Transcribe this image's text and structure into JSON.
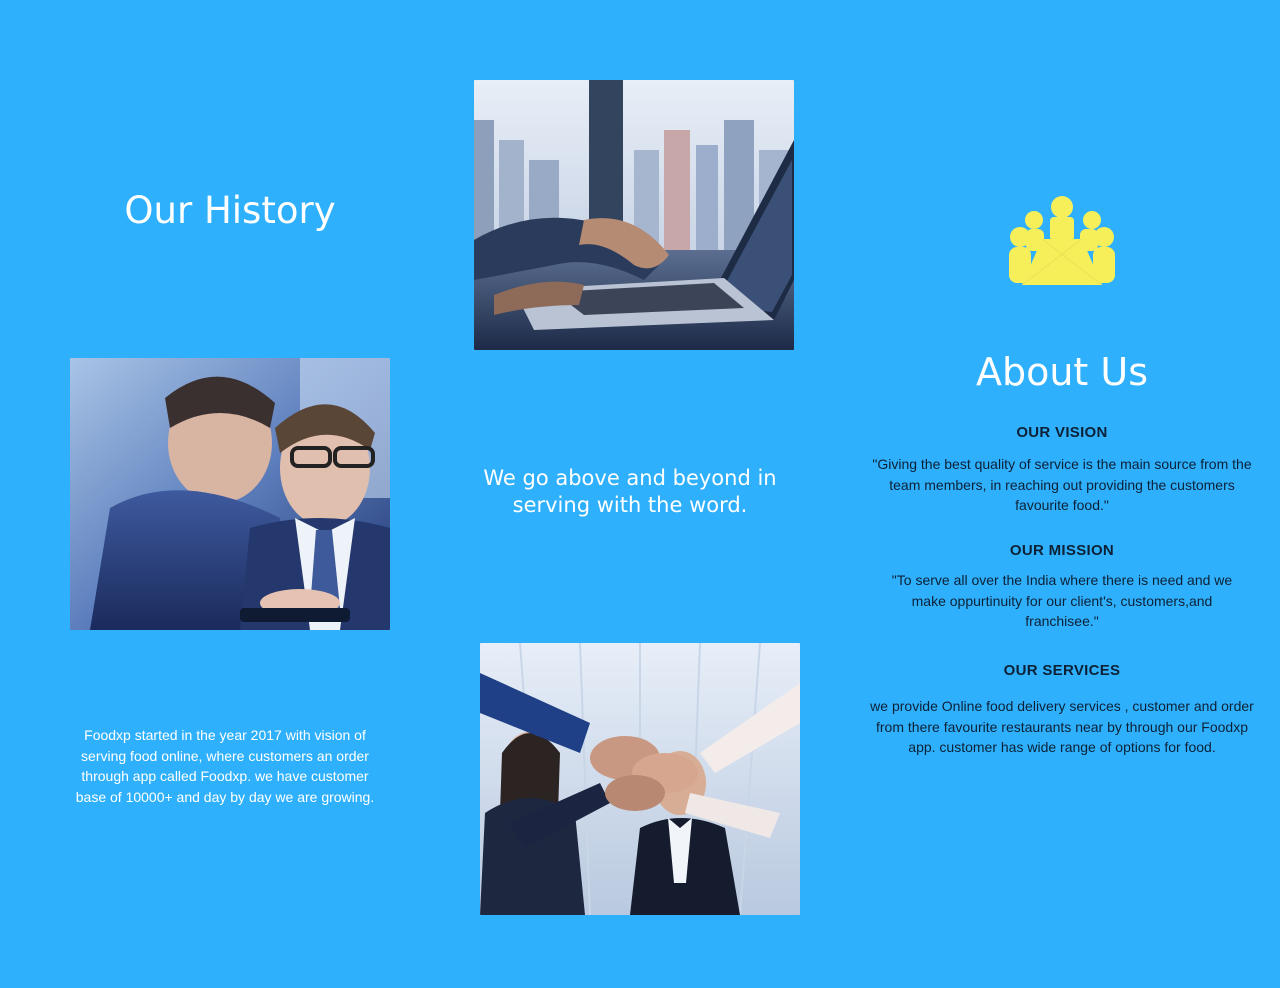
{
  "history": {
    "title": "Our History",
    "description": "Foodxp started in the year 2017 with vision of serving food online, where customers an order through app called Foodxp. we have customer base of 10000+ and day by day we are growing."
  },
  "center": {
    "tagline_line1": "We go above and beyond in",
    "tagline_line2": "serving with the word."
  },
  "about": {
    "icon": "team-meeting-icon",
    "title": "About Us",
    "vision": {
      "title": "OUR VISION",
      "text": "\"Giving the best quality of service is the main source from the team members, in reaching out providing the customers favourite food.\""
    },
    "mission": {
      "title": "OUR MISSION",
      "text": "\"To serve all over the India where there is need and we make oppurtinuity for our client's, customers,and franchisee.\""
    },
    "services": {
      "title": "OUR SERVICES",
      "text": "we provide Online food delivery services , customer and order from there favourite restaurants near by through our Foodxp app. customer has wide range of options for food."
    }
  },
  "colors": {
    "background": "#2fb0fd",
    "icon_yellow": "#f7ef5a",
    "heading_text": "#ffffff",
    "section_text": "#0d2136"
  }
}
